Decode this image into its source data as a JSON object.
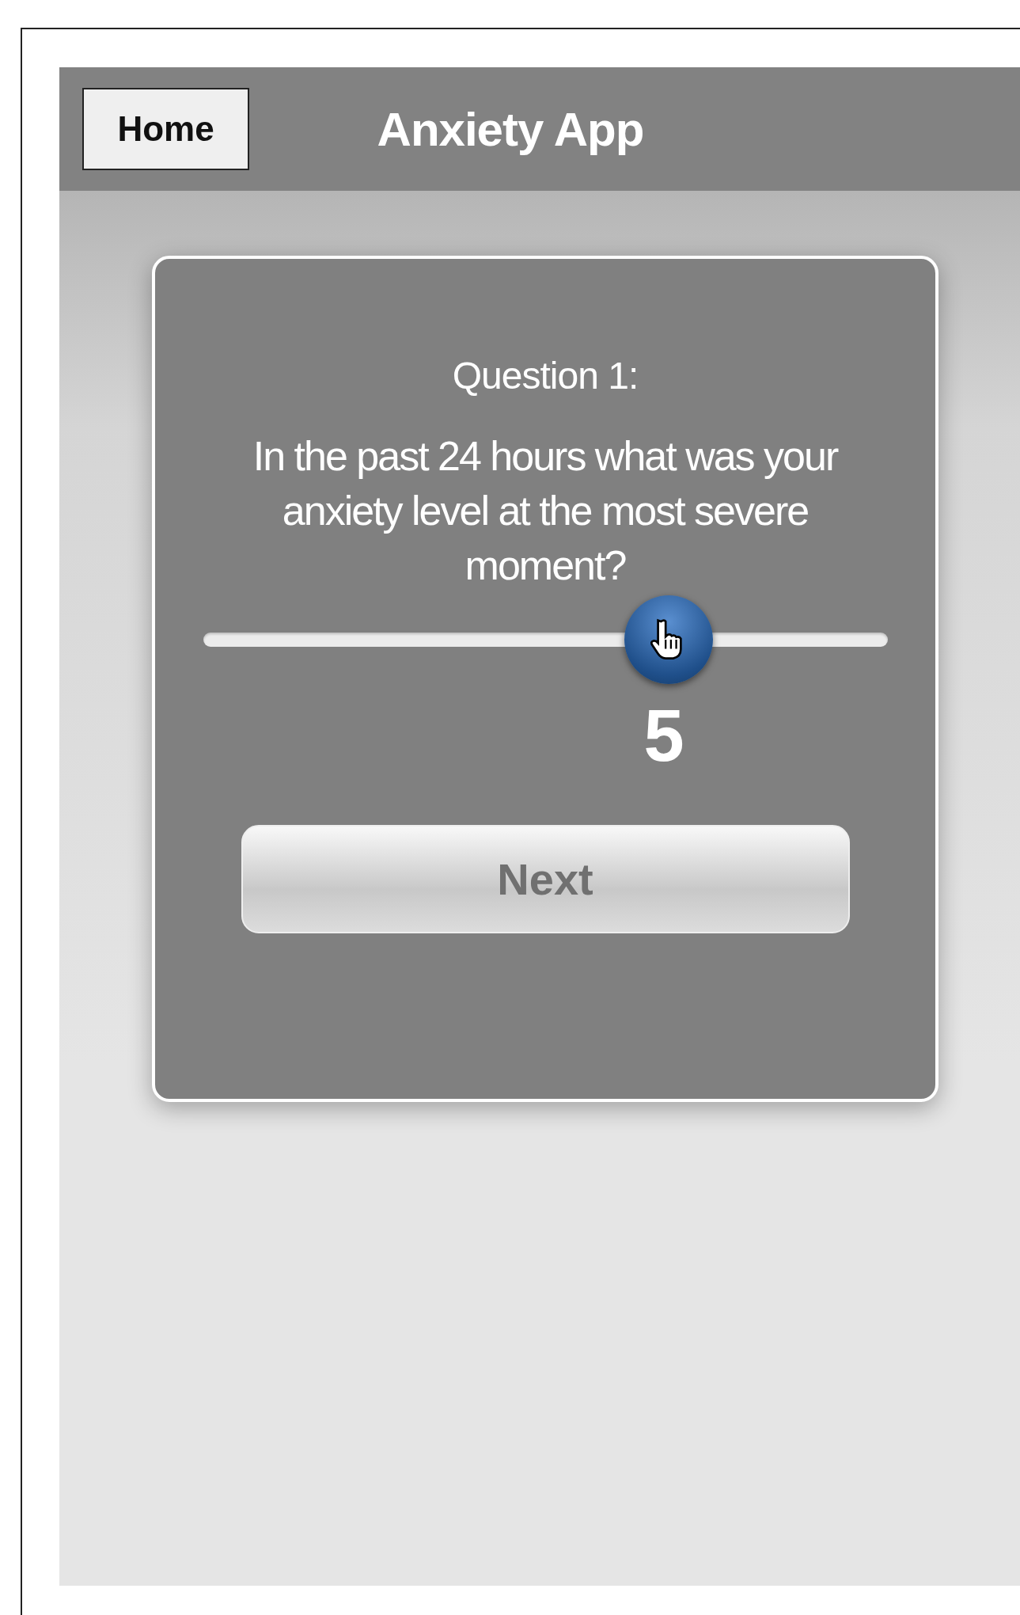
{
  "header": {
    "home_button": "Home",
    "title": "Anxiety App"
  },
  "question": {
    "heading": "Question 1:",
    "text": "In the past 24 hours what was your anxiety level at the most severe moment?"
  },
  "slider": {
    "level": 0.68,
    "value": "5"
  },
  "buttons": [
    "Next"
  ]
}
